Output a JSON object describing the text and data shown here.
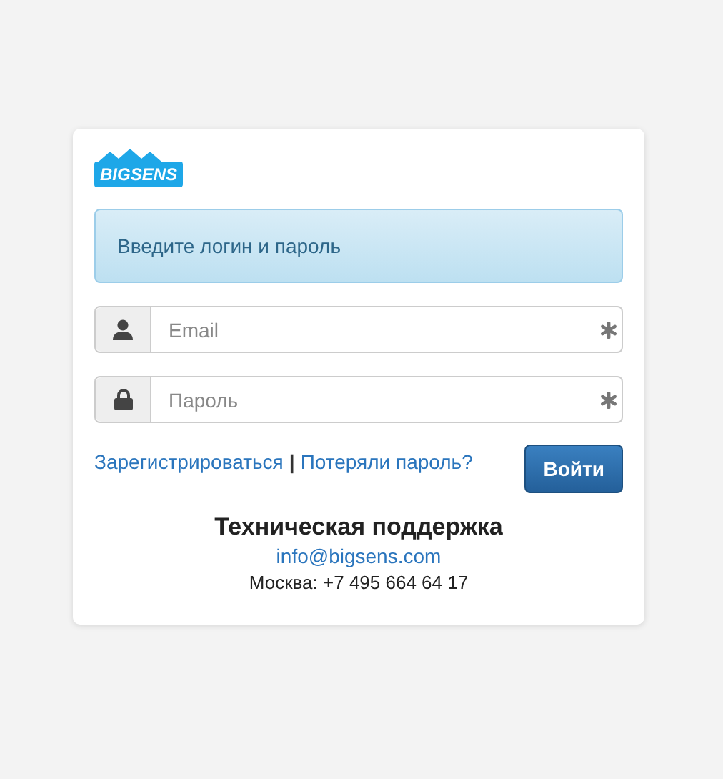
{
  "logo": {
    "text": "BIGSENS"
  },
  "alert": {
    "text": "Введите логин и пароль"
  },
  "fields": [
    {
      "kind": "user",
      "placeholder": "Email",
      "required": true
    },
    {
      "kind": "lock",
      "placeholder": "Пароль",
      "required": true
    }
  ],
  "links": [
    {
      "text": "Зарегистрироваться"
    },
    {
      "text": "Потеряли пароль?"
    }
  ],
  "link_separator": "|",
  "submit_button": "Войти",
  "support": {
    "title": "Техническая поддержка",
    "email": "info@bigsens.com",
    "phone": "Москва: +7 495 664 64 17"
  }
}
